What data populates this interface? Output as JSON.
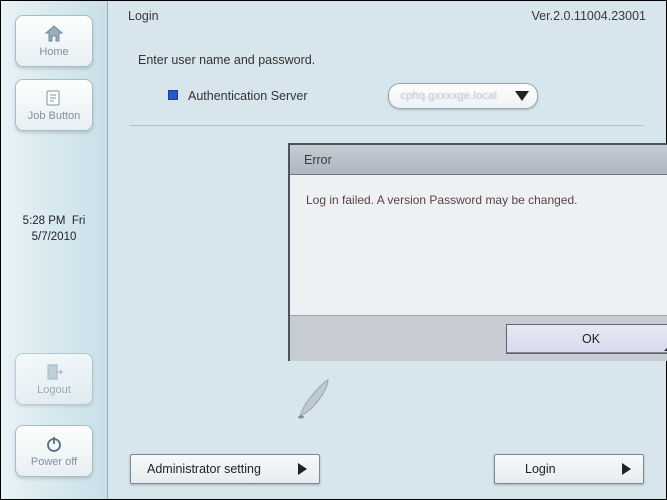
{
  "sidebar": {
    "home_label": "Home",
    "job_button_label": "Job Button",
    "logout_label": "Logout",
    "poweroff_label": "Power off",
    "time": "5:28 PM",
    "day": "Fri",
    "date": "5/7/2010"
  },
  "header": {
    "title": "Login",
    "version": "Ver.2.0.11004.23001"
  },
  "login": {
    "instruction": "Enter user name and password.",
    "auth_server_label": "Authentication Server",
    "auth_server_value": "cphq.gxxxxge.local"
  },
  "error": {
    "title": "Error",
    "message": "Log in failed. A version Password may be changed.",
    "ok_label": "OK"
  },
  "footer": {
    "admin_label": "Administrator setting",
    "login_label": "Login"
  }
}
